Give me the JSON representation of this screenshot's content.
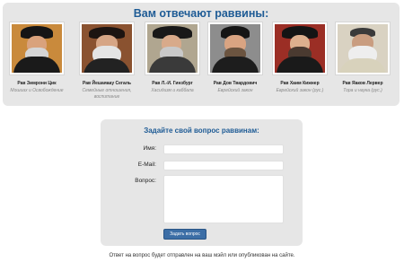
{
  "rabbis_section": {
    "title": "Вам отвечают раввины:",
    "rabbis": [
      {
        "name": "Рав Зимрони Цик",
        "topic": "Мошиах и Освобождение"
      },
      {
        "name": "Рав Йешаяаау Сегаль",
        "topic": "Семейные отношения, воспитание"
      },
      {
        "name": "Рав Л.-И. Гинзбург",
        "topic": "Хасидизм и каббала"
      },
      {
        "name": "Рав Дов Твардович",
        "topic": "Еврейский закон"
      },
      {
        "name": "Рав Хаим Кижнер",
        "topic": "Еврейский закон (рус.)"
      },
      {
        "name": "Рав Яаков Лервер",
        "topic": "Тора и наука (рус.)"
      }
    ]
  },
  "question_form": {
    "title": "Задайте свой вопрос раввинам:",
    "name_label": "Имя:",
    "email_label": "E-Mail:",
    "question_label": "Вопрос:",
    "submit_label": "Задать вопрос"
  },
  "footer_note": "Ответ на вопрос будет отправлен на ваш мэйл или опубликован на сайте."
}
